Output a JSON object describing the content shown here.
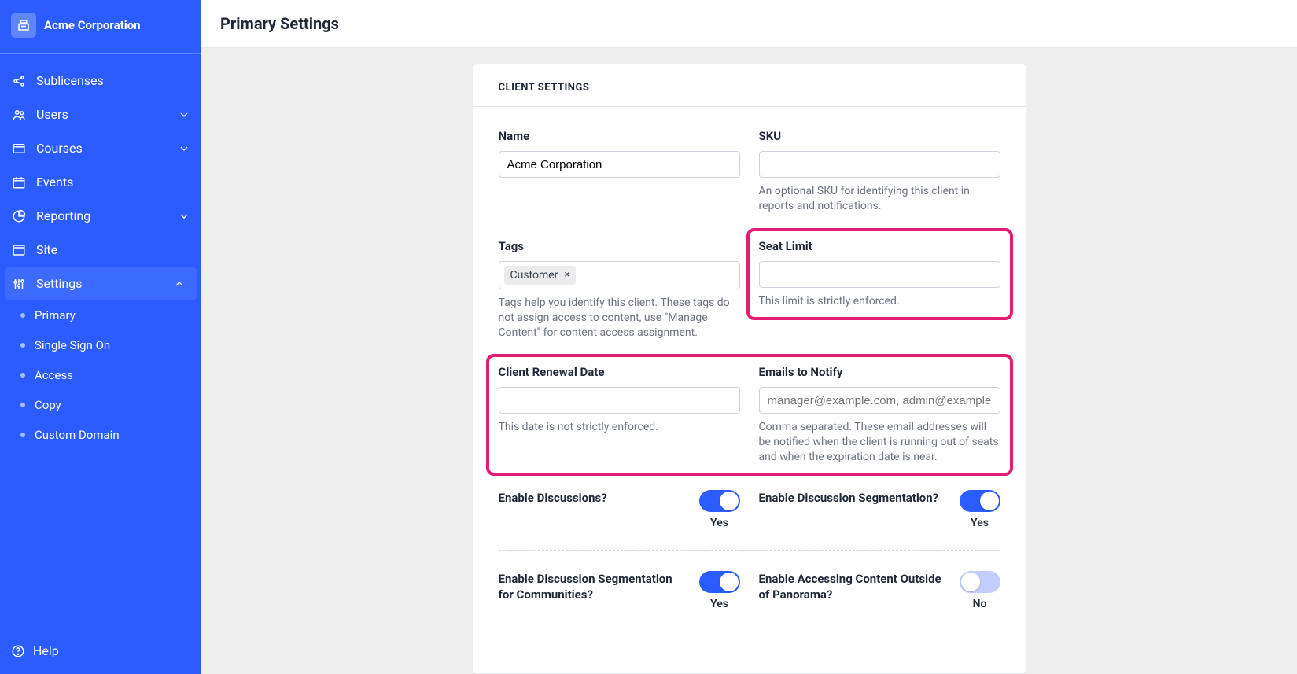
{
  "brand": {
    "name": "Acme Corporation"
  },
  "sidebar": {
    "items": [
      {
        "label": "Sublicenses",
        "expandable": false
      },
      {
        "label": "Users",
        "expandable": true
      },
      {
        "label": "Courses",
        "expandable": true
      },
      {
        "label": "Events",
        "expandable": false
      },
      {
        "label": "Reporting",
        "expandable": true
      },
      {
        "label": "Site",
        "expandable": false
      },
      {
        "label": "Settings",
        "expandable": true
      }
    ],
    "settings_subitems": [
      {
        "label": "Primary"
      },
      {
        "label": "Single Sign On"
      },
      {
        "label": "Access"
      },
      {
        "label": "Copy"
      },
      {
        "label": "Custom Domain"
      }
    ],
    "help": "Help"
  },
  "page": {
    "title": "Primary Settings",
    "section_title": "CLIENT SETTINGS"
  },
  "fields": {
    "name": {
      "label": "Name",
      "value": "Acme Corporation"
    },
    "sku": {
      "label": "SKU",
      "value": "",
      "help": "An optional SKU for identifying this client in reports and notifications."
    },
    "tags": {
      "label": "Tags",
      "value": "Customer",
      "help": "Tags help you identify this client. These tags do not assign access to content, use \"Manage Content\" for content access assignment."
    },
    "seat_limit": {
      "label": "Seat Limit",
      "value": "",
      "help": "This limit is strictly enforced."
    },
    "renewal": {
      "label": "Client Renewal Date",
      "value": "",
      "help": "This date is not strictly enforced."
    },
    "emails": {
      "label": "Emails to Notify",
      "value": "",
      "placeholder": "manager@example.com, admin@example.com",
      "help": "Comma separated. These email addresses will be notified when the client is running out of seats and when the expiration date is near."
    }
  },
  "toggles": {
    "discussions": {
      "label": "Enable Discussions?",
      "state": "Yes",
      "on": true
    },
    "discussion_seg": {
      "label": "Enable Discussion Segmentation?",
      "state": "Yes",
      "on": true
    },
    "discussion_seg_comm": {
      "label": "Enable Discussion Segmentation for Communities?",
      "state": "Yes",
      "on": true
    },
    "outside_panorama": {
      "label": "Enable Accessing Content Outside of Panorama?",
      "state": "No",
      "on": false
    }
  }
}
